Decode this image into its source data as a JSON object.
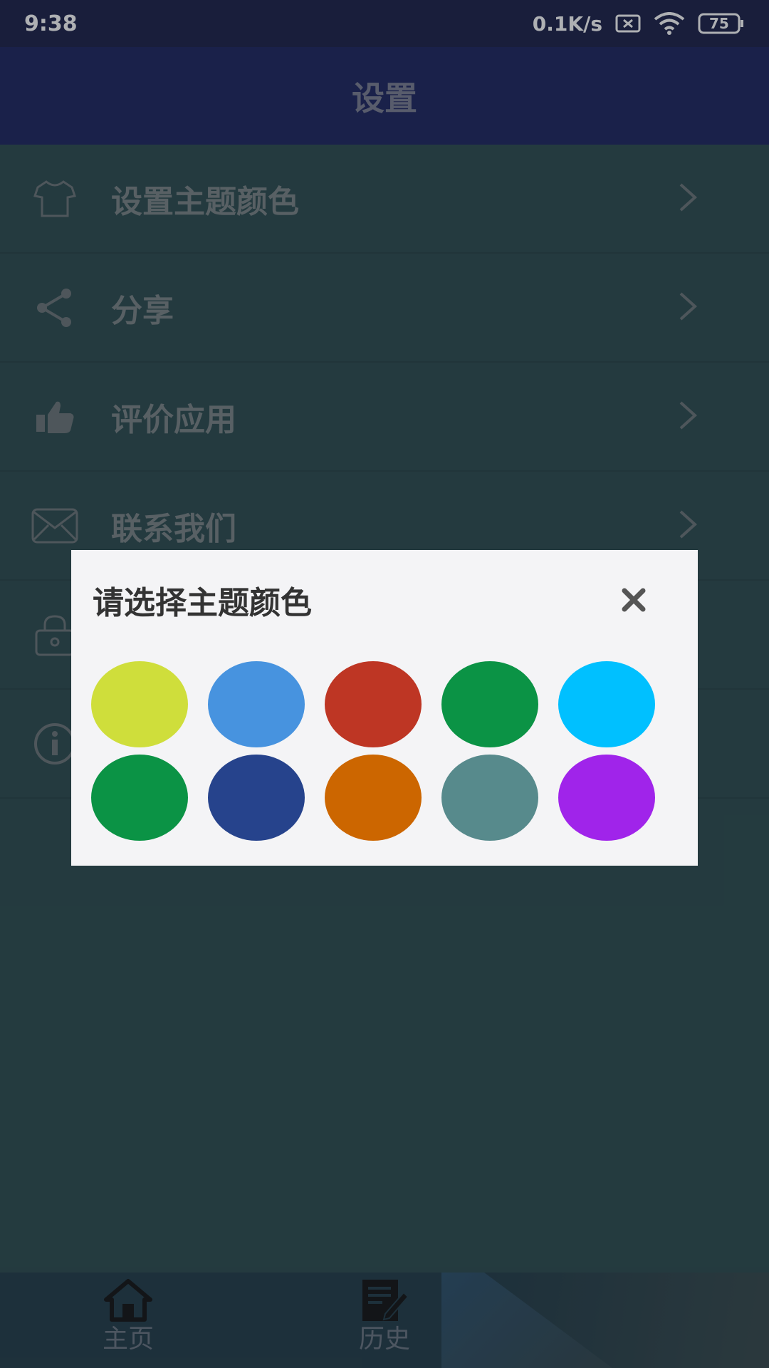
{
  "status_bar": {
    "time": "9:38",
    "network_speed": "0.1K/s",
    "battery": "75"
  },
  "header": {
    "title": "设置"
  },
  "settings": {
    "items": [
      {
        "label": "设置主题颜色",
        "icon": "tshirt-icon"
      },
      {
        "label": "分享",
        "icon": "share-icon"
      },
      {
        "label": "评价应用",
        "icon": "thumbs-up-icon"
      },
      {
        "label": "联系我们",
        "icon": "mail-icon"
      },
      {
        "label": "",
        "icon": "lock-icon"
      },
      {
        "label": "",
        "icon": "info-icon"
      }
    ]
  },
  "dialog": {
    "title": "请选择主题颜色",
    "colors": [
      "#cfde3b",
      "#4793df",
      "#be3624",
      "#0b9345",
      "#00c0ff",
      "#0b9345",
      "#26438c",
      "#cc6600",
      "#578a8c",
      "#a024ea"
    ]
  },
  "bottom_nav": {
    "items": [
      {
        "label": "主页",
        "icon": "home-icon"
      },
      {
        "label": "历史",
        "icon": "history-edit-icon"
      }
    ]
  },
  "colors": {
    "status_bar": "#1b2047",
    "top_bar": "#1c245f",
    "content_bg": "#2b4b4e",
    "dialog_bg": "#f4f4f6"
  }
}
